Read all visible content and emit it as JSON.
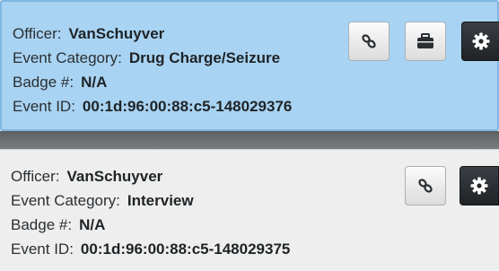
{
  "events": [
    {
      "selected": true,
      "officer_label": "Officer:",
      "officer": "VanSchuyver",
      "category_label": "Event Category:",
      "category": "Drug Charge/Seizure",
      "badge_label": "Badge #:",
      "badge": "N/A",
      "event_id_label": "Event ID:",
      "event_id": "00:1d:96:00:88:c5-148029376",
      "actions": [
        "link-icon",
        "briefcase-icon",
        "gear-icon"
      ]
    },
    {
      "selected": false,
      "officer_label": "Officer:",
      "officer": "VanSchuyver",
      "category_label": "Event Category:",
      "category": "Interview",
      "badge_label": "Badge #:",
      "badge": "N/A",
      "event_id_label": "Event ID:",
      "event_id": "00:1d:96:00:88:c5-148029375",
      "actions": [
        "link-icon",
        "gear-icon"
      ]
    }
  ],
  "colors": {
    "selected_background": "#a9d3f2",
    "normal_background": "#eeeeee",
    "dark_button": "#24282c",
    "text": "#2a2f33"
  }
}
